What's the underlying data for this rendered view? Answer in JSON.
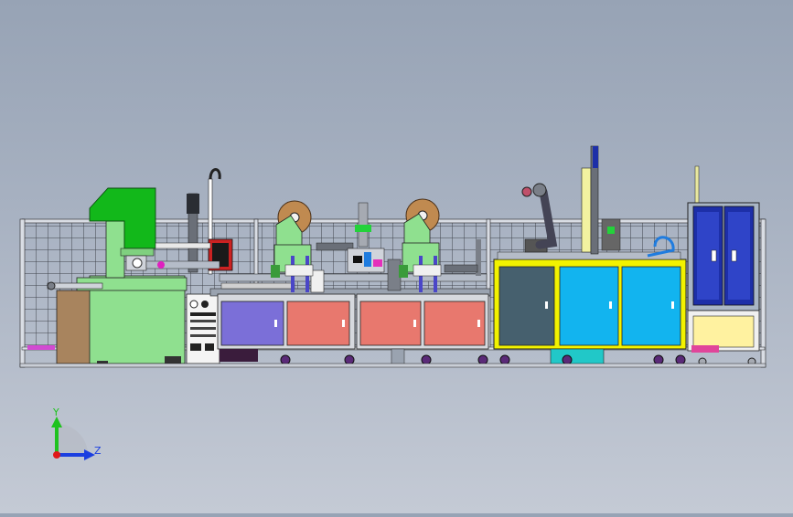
{
  "triad": {
    "y_label": "Y",
    "z_label": "Z",
    "colors": {
      "y": "#1fc21f",
      "z": "#1b3fe0",
      "x": "#e01818"
    }
  },
  "palette": {
    "frame_green": "#8fe08f",
    "press_green": "#12b81a",
    "cabinet_red": "#e8786e",
    "cabinet_purple": "#7b6fd8",
    "cabinet_cyan": "#12b4ef",
    "cabinet_slate": "#46606e",
    "frame_yellow": "#f2f200",
    "cabinet_navy": "#1d2fa8",
    "cabinet_cream": "#fff2a0",
    "reel_brown": "#c08a50",
    "fence": "#d9dde4"
  }
}
